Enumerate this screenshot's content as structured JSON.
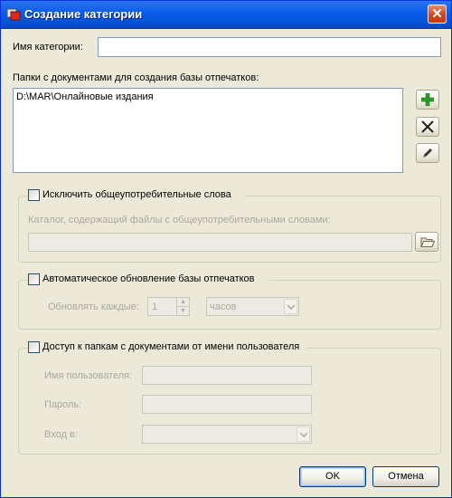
{
  "window": {
    "title": "Создание категории"
  },
  "category_name": {
    "label": "Имя категории:",
    "value": ""
  },
  "folders": {
    "label": "Папки с документами для создания базы отпечатков:",
    "items": [
      "D:\\MAR\\Онлайновые издания"
    ]
  },
  "toolbar": {
    "add_icon": "plus-icon",
    "remove_icon": "x-icon",
    "edit_icon": "pencil-icon"
  },
  "exclude_words": {
    "checkbox_label": "Исключить общеупотребительные слова",
    "checked": false,
    "catalog_label": "Каталог, содержащий файлы с общеупотребительными словами:",
    "path": ""
  },
  "auto_update": {
    "checkbox_label": "Автоматическое обновление базы отпечатков",
    "checked": false,
    "interval_label": "Обновлять каждые:",
    "interval_value": "1",
    "unit": "часов"
  },
  "user_access": {
    "checkbox_label": "Доступ к папкам с документами от имени пользователя",
    "checked": false,
    "username_label": "Имя пользователя:",
    "password_label": "Пароль:",
    "login_label": "Вход в:",
    "username": "",
    "password": "",
    "login": ""
  },
  "buttons": {
    "ok": "OK",
    "cancel": "Отмена"
  },
  "colors": {
    "titlebar": "#0a5ce8",
    "dialog_bg": "#ece9d8",
    "add_green": "#2a9d2a"
  }
}
